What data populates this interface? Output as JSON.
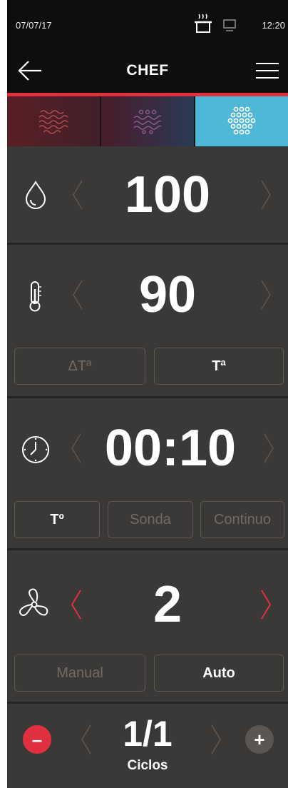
{
  "status_bar": {
    "date": "07/07/17",
    "time": "12:20"
  },
  "header": {
    "title": "CHEF"
  },
  "modes": [
    {
      "name": "steam",
      "icon": "steam-waves-icon"
    },
    {
      "name": "mixed",
      "icon": "mixed-mode-icon"
    },
    {
      "name": "convection",
      "icon": "convection-dots-icon",
      "active": true
    }
  ],
  "humidity": {
    "value": "100",
    "icon": "water-drop-icon"
  },
  "temperature": {
    "value": "90",
    "icon": "thermometer-icon",
    "options": [
      {
        "label": "ΔTª",
        "active": false
      },
      {
        "label": "Tª",
        "active": true
      }
    ]
  },
  "time": {
    "value": "00:10",
    "icon": "clock-icon",
    "options": [
      {
        "label": "Tº",
        "active": true
      },
      {
        "label": "Sonda",
        "active": false
      },
      {
        "label": "Continuo",
        "active": false
      }
    ]
  },
  "fan": {
    "value": "2",
    "icon": "fan-icon",
    "options": [
      {
        "label": "Manual",
        "active": false
      },
      {
        "label": "Auto",
        "active": true
      }
    ]
  },
  "cycles": {
    "value": "1/1",
    "label": "Ciclos",
    "minus": "–",
    "plus": "+"
  },
  "colors": {
    "accent_red": "#e03040",
    "convection_blue": "#4fb8d6",
    "panel": "#3b3937"
  }
}
